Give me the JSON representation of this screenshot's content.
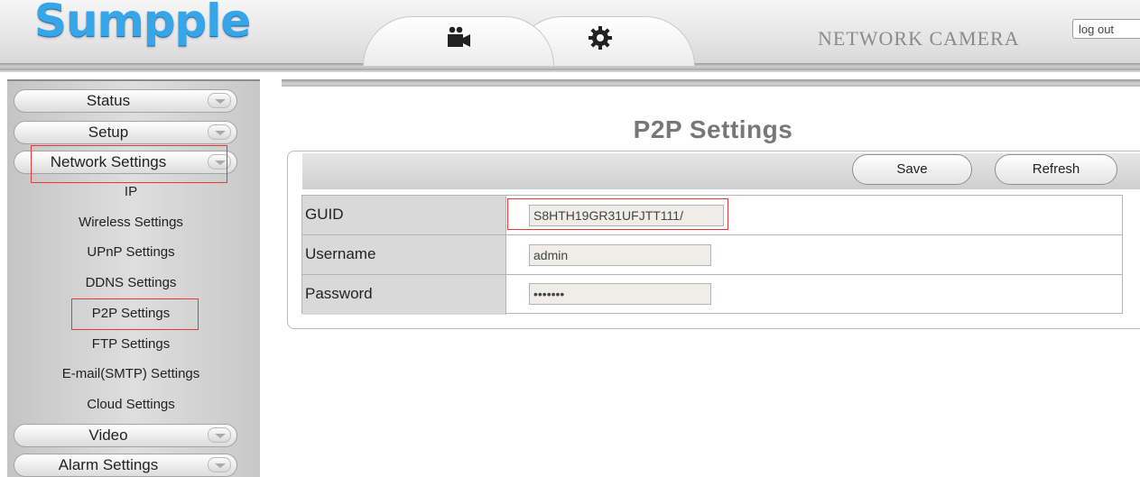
{
  "header": {
    "logo": "Sumpple",
    "tabs": [
      {
        "icon": "camera-icon"
      },
      {
        "icon": "gear-icon"
      }
    ],
    "brand": "NETWORK CAMERA",
    "logout_label": "log out"
  },
  "sidebar": {
    "menus": [
      {
        "label": "Status"
      },
      {
        "label": "Setup"
      },
      {
        "label": "Network Settings"
      },
      {
        "label": "Video"
      },
      {
        "label": "Alarm Settings"
      }
    ],
    "network_items": [
      {
        "label": "IP"
      },
      {
        "label": "Wireless Settings"
      },
      {
        "label": "UPnP Settings"
      },
      {
        "label": "DDNS Settings"
      },
      {
        "label": "P2P Settings"
      },
      {
        "label": "FTP Settings"
      },
      {
        "label": "E-mail(SMTP) Settings"
      },
      {
        "label": "Cloud Settings"
      }
    ]
  },
  "main": {
    "title": "P2P Settings",
    "save_label": "Save",
    "refresh_label": "Refresh",
    "fields": [
      {
        "label": "GUID",
        "value": "S8HTH19GR31UFJTT111/"
      },
      {
        "label": "Username",
        "value": "admin"
      },
      {
        "label": "Password",
        "value": "•••••••"
      }
    ]
  },
  "colors": {
    "logo": "#37a6e8",
    "highlight": "#e63a3a"
  }
}
